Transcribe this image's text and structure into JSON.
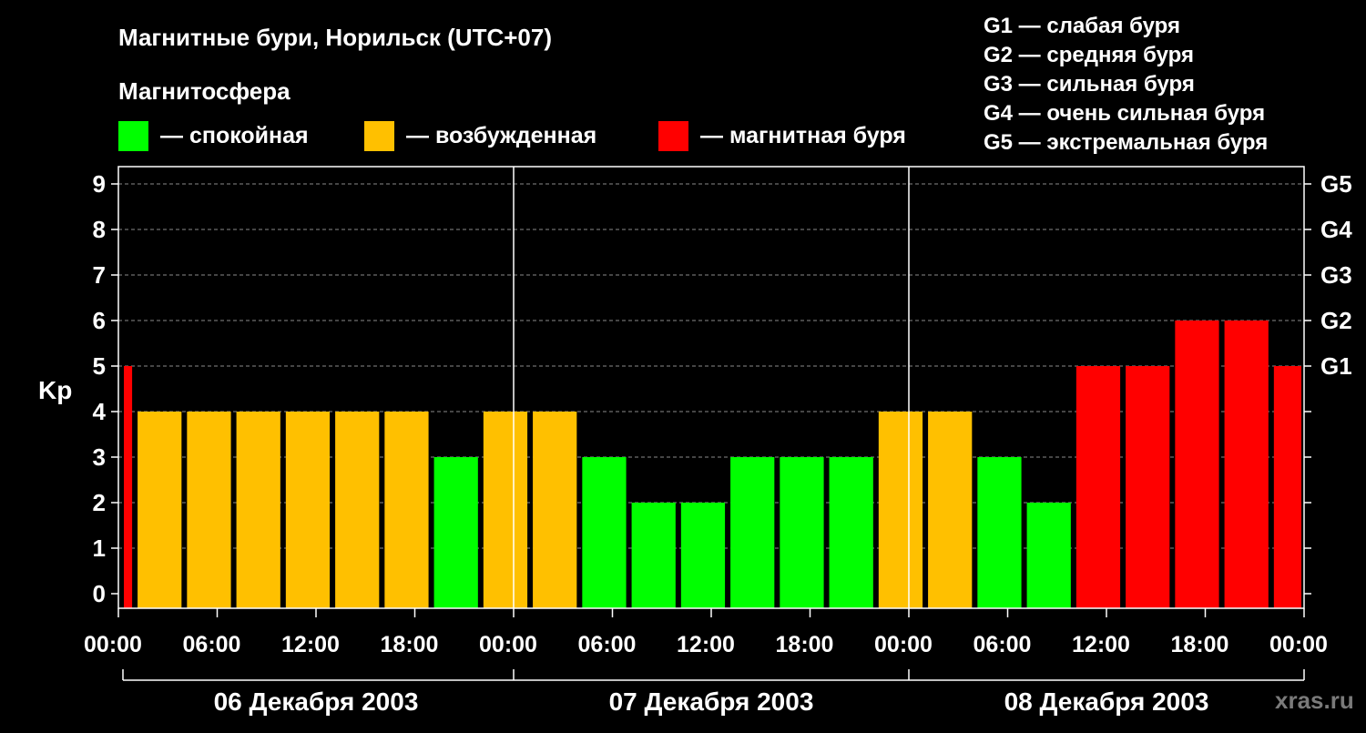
{
  "title": "Магнитные бури, Норильск (UTC+07)",
  "legend": {
    "heading": "Магнитосфера",
    "items": [
      {
        "label": "— спокойная",
        "color": "#00ff00"
      },
      {
        "label": "— возбужденная",
        "color": "#ffc000"
      },
      {
        "label": "— магнитная буря",
        "color": "#ff0000"
      }
    ]
  },
  "g_scale": [
    "G1 — слабая буря",
    "G2 — средняя буря",
    "G3 — сильная буря",
    "G4 — очень сильная буря",
    "G5 — экстремальная буря"
  ],
  "watermark": "xras.ru",
  "colors": {
    "quiet": "#00ff00",
    "active": "#ffc000",
    "storm": "#ff0000"
  },
  "chart_data": {
    "type": "bar",
    "ylabel": "Kp",
    "ylim": [
      0,
      9
    ],
    "y_ticks": [
      "0",
      "1",
      "2",
      "3",
      "4",
      "5",
      "6",
      "7",
      "8",
      "9"
    ],
    "right_ticks": [
      {
        "kp": 5,
        "label": "G1"
      },
      {
        "kp": 6,
        "label": "G2"
      },
      {
        "kp": 7,
        "label": "G3"
      },
      {
        "kp": 8,
        "label": "G4"
      },
      {
        "kp": 9,
        "label": "G5"
      }
    ],
    "x_tick_labels": [
      "00:00",
      "06:00",
      "12:00",
      "18:00",
      "00:00",
      "06:00",
      "12:00",
      "18:00",
      "00:00",
      "06:00",
      "12:00",
      "18:00",
      "00:00"
    ],
    "days": [
      "06 Декабря 2003",
      "07 Декабря 2003",
      "08 Декабря 2003"
    ],
    "grid": "dashed horizontal",
    "interval_hours": 3,
    "first_bar_hours": 1,
    "values": [
      5,
      4,
      4,
      4,
      4,
      4,
      4,
      3,
      4,
      4,
      3,
      2,
      2,
      3,
      3,
      3,
      4,
      4,
      3,
      2,
      5,
      5,
      6,
      6,
      5
    ],
    "categories": [
      "quiet",
      "active",
      "storm"
    ]
  }
}
